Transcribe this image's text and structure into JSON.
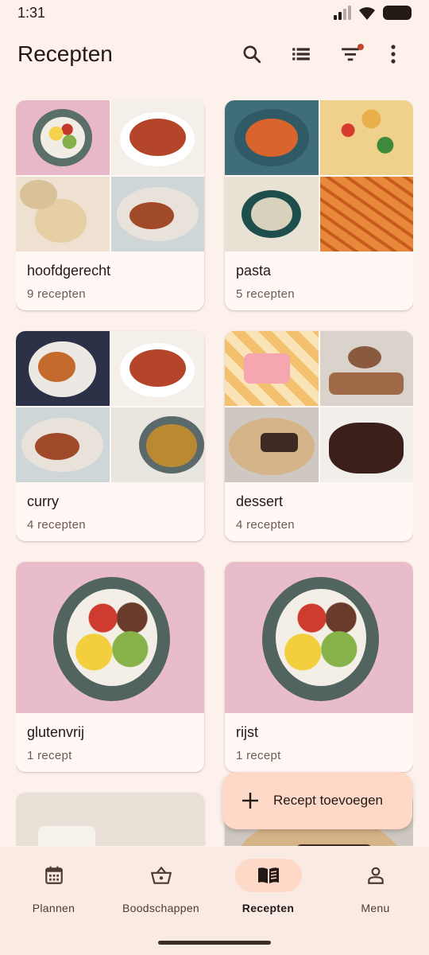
{
  "status_bar": {
    "time": "1:31"
  },
  "app_bar": {
    "title": "Recepten",
    "actions": [
      "search-icon",
      "list-icon",
      "filter-icon",
      "more-vert-icon"
    ],
    "filter_active": true
  },
  "categories": [
    {
      "name": "hoofdgerecht",
      "count": "9 recepten",
      "photos": [
        "ph-bowl",
        "ph-stew",
        "ph-noodles",
        "ph-curryplate"
      ]
    },
    {
      "name": "pasta",
      "count": "5 recepten",
      "photos": [
        "ph-pastabowl",
        "ph-pastasalad",
        "ph-pestopasta",
        "ph-penne"
      ]
    },
    {
      "name": "curry",
      "count": "4 recepten",
      "photos": [
        "ph-tikka",
        "ph-stew",
        "ph-curryplate",
        "ph-dal"
      ]
    },
    {
      "name": "dessert",
      "count": "4 recepten",
      "photos": [
        "ph-cake",
        "ph-cookies",
        "ph-tart",
        "ph-chococake"
      ]
    },
    {
      "name": "glutenvrij",
      "count": "1 recept",
      "photos": [
        "ph-bigbowl"
      ]
    },
    {
      "name": "rijst",
      "count": "1 recept",
      "photos": [
        "ph-bigbowl"
      ]
    },
    {
      "name": "",
      "count": "",
      "photos": [
        "ph-coffee"
      ]
    },
    {
      "name": "",
      "count": "",
      "photos": [
        "ph-tart"
      ]
    }
  ],
  "fab": {
    "label": "Recept toevoegen",
    "icon": "plus-icon"
  },
  "bottom_nav": [
    {
      "label": "Plannen",
      "icon": "calendar-icon",
      "active": false
    },
    {
      "label": "Boodschappen",
      "icon": "basket-icon",
      "active": false
    },
    {
      "label": "Recepten",
      "icon": "book-icon",
      "active": true
    },
    {
      "label": "Menu",
      "icon": "person-icon",
      "active": false
    }
  ],
  "colors": {
    "background": "#fdf1ec",
    "card": "#fff8f5",
    "accent_container": "#ffd9c7",
    "badge": "#c2452d",
    "text": "#231a16"
  }
}
